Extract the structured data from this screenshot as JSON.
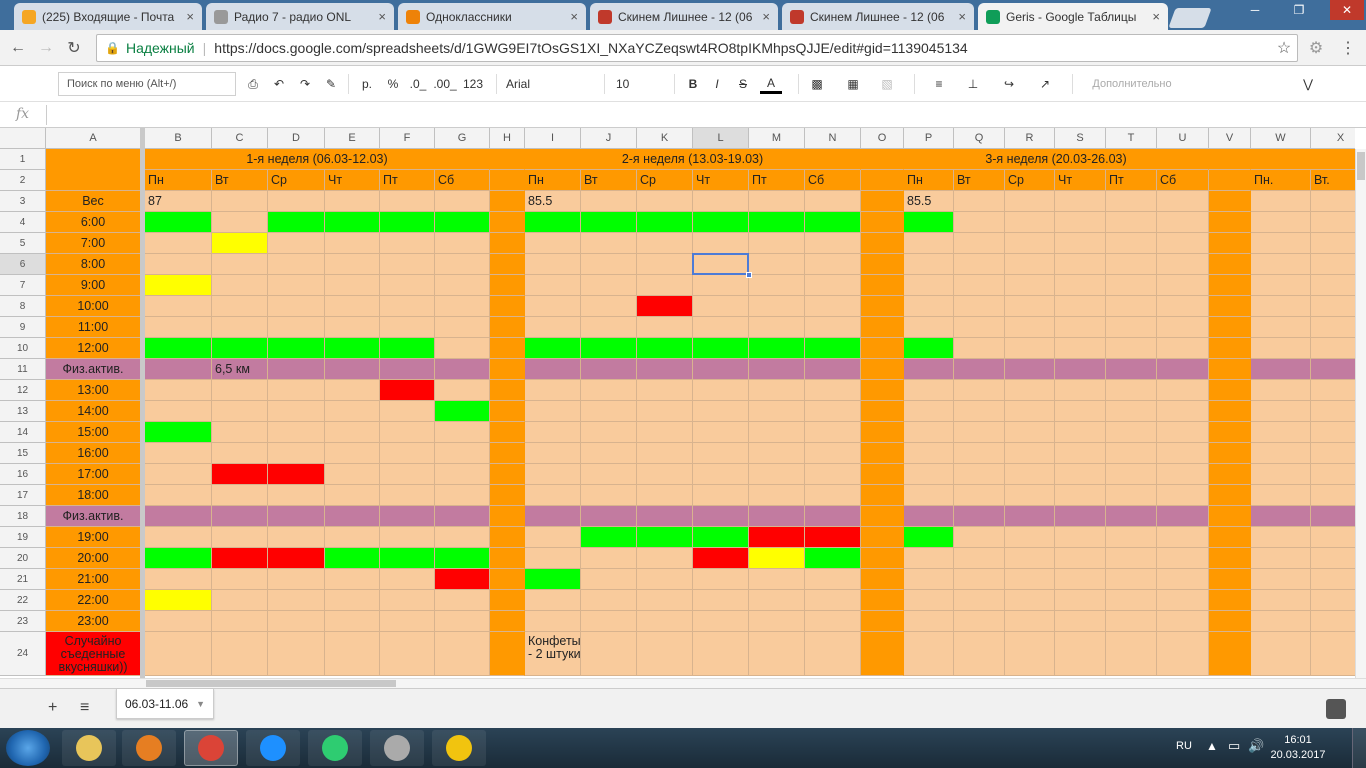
{
  "browser": {
    "tabs": [
      {
        "title": "(225) Входящие - Почта",
        "favicon": "mail-icon",
        "color": "#f5a623",
        "active": false
      },
      {
        "title": "Радио 7 - радио ONL",
        "favicon": "radio-icon",
        "color": "#999999",
        "active": false
      },
      {
        "title": "Одноклассники",
        "favicon": "ok-icon",
        "color": "#ee8208",
        "active": false
      },
      {
        "title": "Скинем Лишнее - 12 (06",
        "favicon": "shield-icon",
        "color": "#c0392b",
        "active": false
      },
      {
        "title": "Скинем Лишнее - 12 (06",
        "favicon": "shield-icon",
        "color": "#c0392b",
        "active": false
      },
      {
        "title": "Geris - Google Таблицы",
        "favicon": "sheets-icon",
        "color": "#0f9d58",
        "active": true
      }
    ],
    "secure_label": "Надежный",
    "url": "https://docs.google.com/spreadsheets/d/1GWG9EI7tOsGS1XI_NXaYCZeqswt4RO8tpIKMhpsQJJE/edit#gid=1139045134"
  },
  "toolbar": {
    "menu_search_placeholder": "Поиск по меню (Alt+/)",
    "currency": "р.",
    "percent": "%",
    "dec_less": ".0_",
    "dec_more": ".00_",
    "format_123": "123",
    "font": "Arial",
    "font_size": "10",
    "bold": "B",
    "italic": "I",
    "strike": "S",
    "text_color": "A",
    "more": "Дополнительно"
  },
  "formula_bar": {
    "fx": "fx",
    "value": ""
  },
  "colors": {
    "orange": "#ff9900",
    "peach": "#f9cb9c",
    "green": "#00ff00",
    "yellow": "#ffff00",
    "red": "#ff0000",
    "purple": "#c27ba0"
  },
  "grid": {
    "columns": [
      "A",
      "B",
      "C",
      "D",
      "E",
      "F",
      "G",
      "H",
      "I",
      "J",
      "K",
      "L",
      "M",
      "N",
      "O",
      "P",
      "Q",
      "R",
      "S",
      "T",
      "U",
      "V",
      "W",
      "X"
    ],
    "selected_column": "L",
    "selected_row": "6",
    "rows": [
      {
        "n": "1",
        "label": ""
      },
      {
        "n": "2",
        "label": ""
      },
      {
        "n": "3",
        "label": "Вес"
      },
      {
        "n": "4",
        "label": "6:00"
      },
      {
        "n": "5",
        "label": "7:00"
      },
      {
        "n": "6",
        "label": "8:00"
      },
      {
        "n": "7",
        "label": "9:00"
      },
      {
        "n": "8",
        "label": "10:00"
      },
      {
        "n": "9",
        "label": "11:00"
      },
      {
        "n": "10",
        "label": "12:00"
      },
      {
        "n": "11",
        "label": "Физ.актив."
      },
      {
        "n": "12",
        "label": "13:00"
      },
      {
        "n": "13",
        "label": "14:00"
      },
      {
        "n": "14",
        "label": "15:00"
      },
      {
        "n": "15",
        "label": "16:00"
      },
      {
        "n": "16",
        "label": "17:00"
      },
      {
        "n": "17",
        "label": "18:00"
      },
      {
        "n": "18",
        "label": "Физ.актив."
      },
      {
        "n": "19",
        "label": "19:00"
      },
      {
        "n": "20",
        "label": "20:00"
      },
      {
        "n": "21",
        "label": "21:00"
      },
      {
        "n": "22",
        "label": "22:00"
      },
      {
        "n": "23",
        "label": "23:00"
      },
      {
        "n": "24",
        "label": "Случайно съеденные вкусняшки))"
      }
    ],
    "week_headers": [
      {
        "text": "1-я неделя (06.03-12.03)",
        "from": "B",
        "to": "G"
      },
      {
        "text": "2-я неделя (13.03-19.03)",
        "from": "I",
        "to": "N"
      },
      {
        "text": "3-я неделя (20.03-26.03)",
        "from": "P",
        "to": "U"
      }
    ],
    "day_labels": {
      "B": "Пн",
      "C": "Вт",
      "D": "Ср",
      "E": "Чт",
      "F": "Пт",
      "G": "Сб",
      "I": "Пн",
      "J": "Вт",
      "K": "Ср",
      "L": "Чт",
      "M": "Пт",
      "N": "Сб",
      "P": "Пн",
      "Q": "Вт",
      "R": "Ср",
      "S": "Чт",
      "T": "Пт",
      "U": "Сб",
      "W": "Пн.",
      "X": "Вт."
    },
    "values": [
      {
        "cell": "B3",
        "text": "87"
      },
      {
        "cell": "I3",
        "text": "85.5"
      },
      {
        "cell": "P3",
        "text": "85.5"
      },
      {
        "cell": "C11",
        "text": "6,5 км"
      },
      {
        "cell": "I24",
        "text": "Конфеты - 2 штуки"
      }
    ],
    "marks": {
      "green": [
        "B4",
        "D4",
        "E4",
        "F4",
        "G4",
        "I4",
        "J4",
        "K4",
        "L4",
        "M4",
        "N4",
        "P4",
        "B10",
        "C10",
        "D10",
        "E10",
        "F10",
        "I10",
        "J10",
        "K10",
        "L10",
        "M10",
        "N10",
        "P10",
        "G13",
        "B14",
        "J19",
        "K19",
        "L19",
        "P19",
        "B20",
        "E20",
        "F20",
        "G20",
        "N20",
        "I21"
      ],
      "yellow": [
        "C5",
        "B7",
        "M20",
        "B22"
      ],
      "red": [
        "K8",
        "F12",
        "C16",
        "D16",
        "M19",
        "N19",
        "C20",
        "D20",
        "L20",
        "G21"
      ]
    }
  },
  "sheet_tab": {
    "name": "06.03-11.06"
  },
  "taskbar": {
    "lang": "RU",
    "time": "16:01",
    "date": "20.03.2017",
    "apps": [
      {
        "name": "explorer-icon",
        "color": "#e8c55a"
      },
      {
        "name": "media-player-icon",
        "color": "#e67e22"
      },
      {
        "name": "chrome-icon",
        "color": "#db4437"
      },
      {
        "name": "ie-icon",
        "color": "#1e90ff"
      },
      {
        "name": "mail-agent-icon",
        "color": "#2ecc71"
      },
      {
        "name": "radio-app-icon",
        "color": "#aaaaaa"
      },
      {
        "name": "1c-icon",
        "color": "#f1c40f"
      }
    ]
  }
}
